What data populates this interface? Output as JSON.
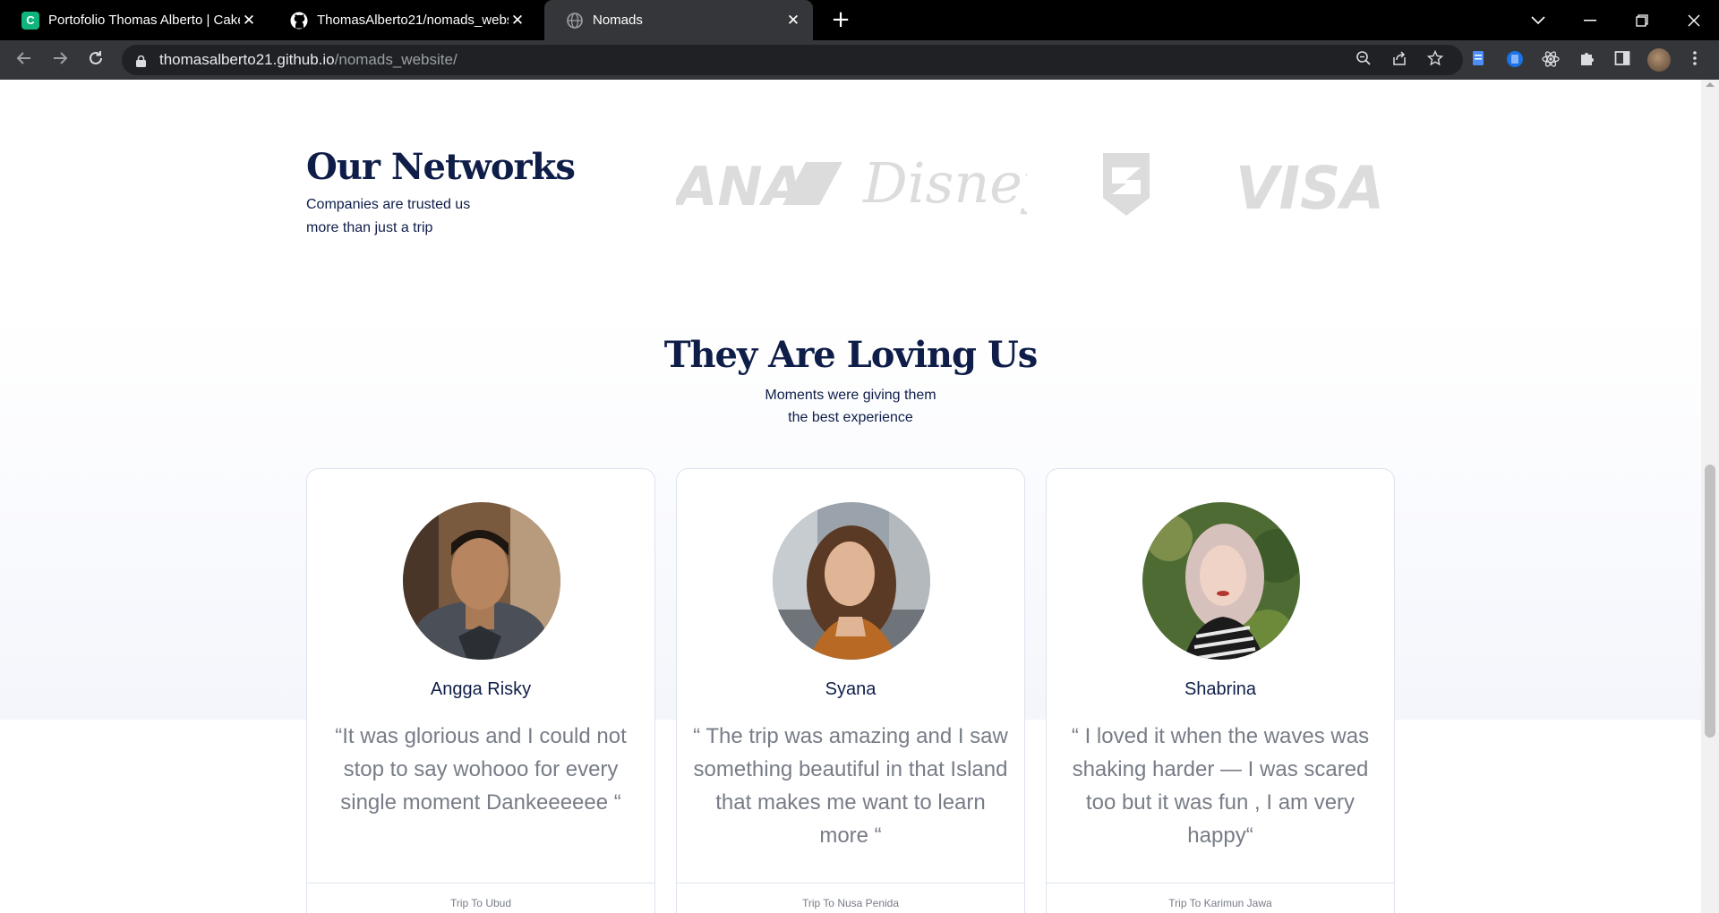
{
  "browser": {
    "tabs": [
      {
        "title": "Portofolio Thomas Alberto | Cake",
        "favicon": "cakeresume-icon",
        "favicon_letter": "C",
        "favicon_color": "#10b47f"
      },
      {
        "title": "ThomasAlberto21/nomads_webs",
        "favicon": "github-icon"
      },
      {
        "title": "Nomads",
        "favicon": "globe-icon"
      }
    ],
    "url_host": "thomasalberto21.github.io",
    "url_path": "/nomads_website/"
  },
  "networks": {
    "title": "Our Networks",
    "subtitle": "Companies are trusted us more than just a trip",
    "logos": [
      "ANA",
      "Disney",
      "shield-logo",
      "VISA"
    ]
  },
  "testimonials": {
    "title": "They Are Loving Us",
    "subtitle_line1": "Moments were giving them",
    "subtitle_line2": "the best experience",
    "cards": [
      {
        "name": "Angga Risky",
        "quote": "“It was glorious and I could not stop to say wohooo for every single moment Dankeeeeee “",
        "trip": "Trip To Ubud"
      },
      {
        "name": "Syana",
        "quote": "“ The trip was amazing and I saw something beautiful in that Island that makes me want to learn more “",
        "trip": "Trip To Nusa Penida"
      },
      {
        "name": "Shabrina",
        "quote": "“ I loved it when the waves was shaking harder — I was scared too but it was fun , I am very happy“",
        "trip": "Trip To Karimun Jawa"
      }
    ]
  },
  "colors": {
    "navy": "#0f1e49",
    "muted": "#777c87",
    "logo_gray": "#dcdcdc"
  }
}
